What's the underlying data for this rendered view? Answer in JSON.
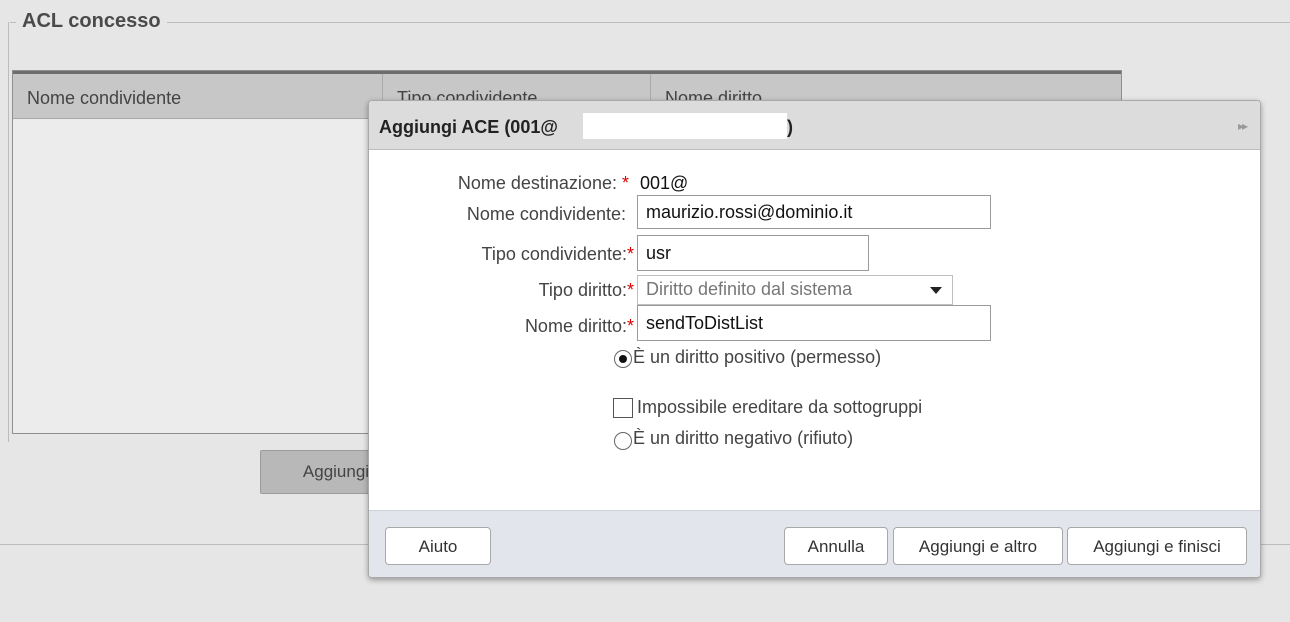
{
  "fieldset": {
    "legend": "ACL concesso"
  },
  "bg_table": {
    "columns": [
      "Nome condividente",
      "Tipo condividente",
      "Nome diritto"
    ]
  },
  "bg_button": {
    "label": "Aggiungi"
  },
  "dialog": {
    "title": "Aggiungi ACE (001@",
    "title_close_paren": ")",
    "fields": {
      "dest_label": "Nome destinazione:",
      "dest_value": "001@",
      "grantee_name_label": "Nome condividente:",
      "grantee_name_value": "maurizio.rossi@dominio.it",
      "grantee_type_label": "Tipo condividente:",
      "grantee_type_value": "usr",
      "right_type_label": "Tipo diritto:",
      "right_type_value": "Diritto definito dal sistema",
      "right_name_label": "Nome diritto:",
      "right_name_value": "sendToDistList",
      "required_mark": "*"
    },
    "options": {
      "positive": "È un diritto positivo (permesso)",
      "no_inherit": "Impossibile ereditare da sottogruppi",
      "negative": "È un diritto negativo (rifiuto)",
      "positive_selected": true,
      "no_inherit_checked": false
    },
    "footer": {
      "help": "Aiuto",
      "cancel": "Annulla",
      "add_more": "Aggiungi e altro",
      "add_finish": "Aggiungi e finisci"
    }
  }
}
